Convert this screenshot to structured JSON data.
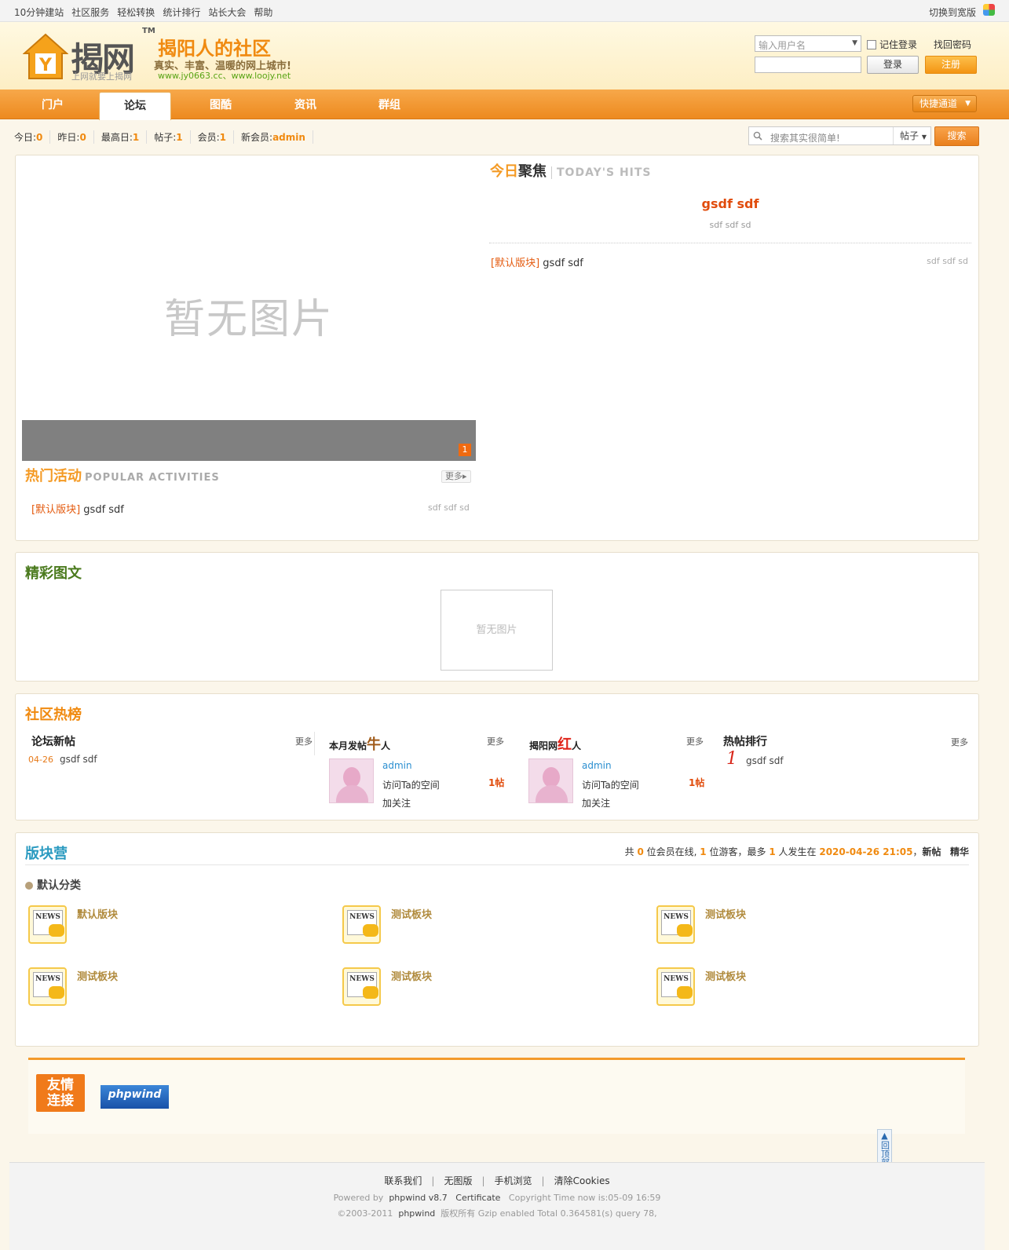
{
  "topbar": {
    "links": [
      "10分钟建站",
      "社区服务",
      "轻松转换",
      "统计排行",
      "站长大会",
      "帮助"
    ],
    "switch_label": "切换到宽版"
  },
  "header": {
    "logo_text": "揭网",
    "logo_tm": "TM",
    "logo_sub": "上网就要上揭网",
    "slogan_title": "揭阳人的社区",
    "slogan_line": "真实、丰富、温暖的网上城市!",
    "slogan_url": "www.jy0663.cc、www.loojy.net",
    "login": {
      "username_placeholder": "输入用户名",
      "remember_label": "记住登录",
      "forgot_label": "找回密码",
      "login_button": "登录",
      "register_button": "注册"
    }
  },
  "nav": {
    "items": [
      "门户",
      "论坛",
      "图酷",
      "资讯",
      "群组"
    ],
    "active": "论坛",
    "quick_label": "快捷通道"
  },
  "stats": {
    "today_label": "今日:",
    "today": "0",
    "yesterday_label": "昨日:",
    "yesterday": "0",
    "peak_label": "最高日:",
    "peak": "1",
    "posts_label": "帖子:",
    "posts": "1",
    "members_label": "会员:",
    "members": "1",
    "newest_label": "新会员:",
    "newest": "admin"
  },
  "search": {
    "placeholder": "搜索其实很简单!",
    "type": "帖子",
    "button": "搜索"
  },
  "slideshow": {
    "no_image": "暂无图片",
    "page": "1"
  },
  "todays_hits": {
    "title_cn1": "今日",
    "title_cn2": "聚焦",
    "title_en": "TODAY'S HITS",
    "headline": "gsdf sdf",
    "headline_sub": "sdf sdf sd",
    "items": [
      {
        "category": "[默认版块]",
        "title": "gsdf sdf",
        "meta": "sdf sdf sd"
      }
    ]
  },
  "popular_activities": {
    "title_cn": "热门活动",
    "title_en": "POPULAR ACTIVITIES",
    "more": "更多",
    "items": [
      {
        "category": "[默认版块]",
        "title": "gsdf sdf",
        "meta": "sdf sdf sd"
      }
    ]
  },
  "featured": {
    "title": "精彩图文",
    "no_image": "暂无图片"
  },
  "hot_list": {
    "title": "社区热榜",
    "new_posts": {
      "title": "论坛新帖",
      "more": "更多",
      "items": [
        {
          "date": "04-26",
          "title": "gsdf sdf"
        }
      ]
    },
    "top_poster": {
      "title_a": "本月发帖",
      "title_b": "牛",
      "title_c": "人",
      "more": "更多",
      "user": "admin",
      "visit": "访问Ta的空间",
      "follow": "加关注",
      "count": "1帖"
    },
    "red_person": {
      "title_a": "揭阳网",
      "title_b": "红",
      "title_c": "人",
      "more": "更多",
      "user": "admin",
      "visit": "访问Ta的空间",
      "follow": "加关注",
      "count": "1帖"
    },
    "hot_ranking": {
      "title": "热帖排行",
      "more": "更多",
      "items": [
        {
          "rank": "1",
          "title": "gsdf sdf"
        }
      ]
    }
  },
  "forums": {
    "title": "版块营",
    "online": {
      "prefix": "共",
      "members": "0",
      "mid1": "位会员在线,",
      "guests": "1",
      "mid2": "位游客，最多",
      "max": "1",
      "mid3": "人发生在",
      "time": "2020-04-26 21:05",
      "sep": "，",
      "new": "新帖",
      "digest": "精华"
    },
    "category": "默认分类",
    "icon_text": "NEWS",
    "items": [
      "默认版块",
      "测试板块",
      "测试板块",
      "测试板块",
      "测试板块",
      "测试板块"
    ]
  },
  "friend_links": {
    "badge_line1": "友情",
    "badge_line2": "连接",
    "partner": "phpwind"
  },
  "back_top": "回顶部",
  "footer": {
    "links": [
      "联系我们",
      "无图版",
      "手机浏览",
      "清除Cookies"
    ],
    "powered_prefix": "Powered by",
    "powered_name": "phpwind v8.7",
    "certificate": "Certificate",
    "time_text": "Copyright Time now is:05-09 16:59",
    "copy_prefix": "©2003-2011",
    "copy_name": "phpwind",
    "copy_suffix": "版权所有 Gzip enabled Total 0.364581(s) query 78,"
  },
  "colors": {
    "accent": "#f08a10",
    "nav": "#ed8a1f",
    "link_red": "#e14c0c"
  }
}
